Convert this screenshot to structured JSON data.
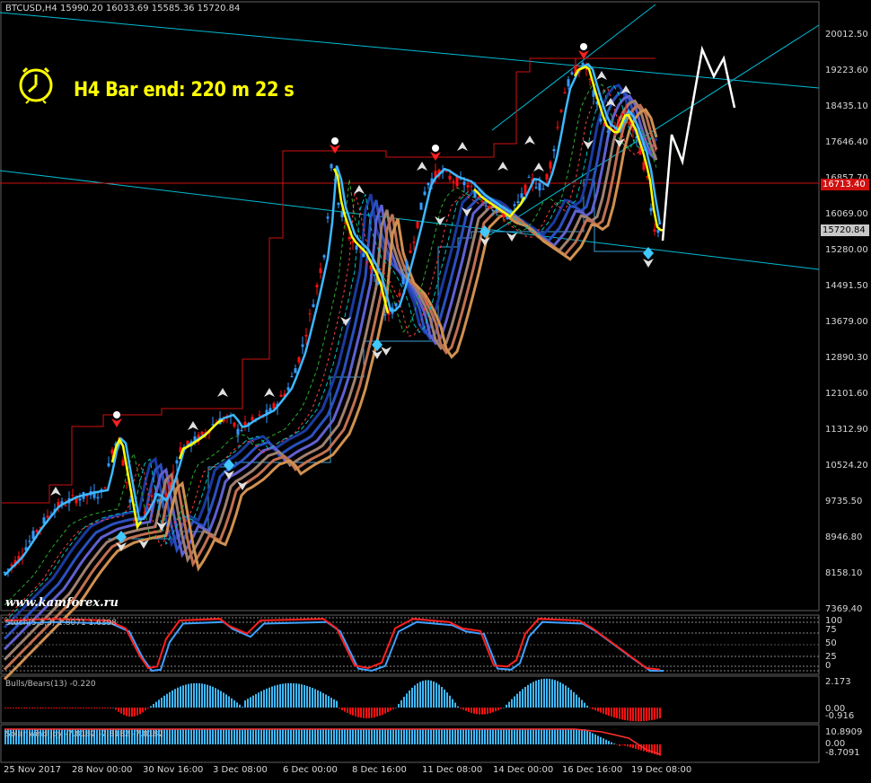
{
  "header": {
    "symbol_info": "BTCUSD,H4  15990.20 16033.69 15585.36 15720.84",
    "timer_text": "H4 Bar end: 220 m 22 s",
    "watermark": "www.kamforex.ru"
  },
  "price_axis": {
    "ticks": [
      "20012.50",
      "19223.60",
      "18435.10",
      "17646.40",
      "16857.70",
      "16069.00",
      "15280.00",
      "14491.50",
      "13679.00",
      "12890.30",
      "12101.60",
      "11312.90",
      "10524.20",
      "9735.50",
      "8946.80",
      "8158.10",
      "7369.40"
    ],
    "red_line_label": "16713.40",
    "current_label": "15720.84"
  },
  "stoch_panel": {
    "label": "Stoch(5,3,3) 1.8071 1.6398",
    "levels": [
      "100",
      "75",
      "50",
      "25",
      "0"
    ]
  },
  "ao_panel": {
    "label": "Bulls/Bears(13) -0.220",
    "levels": [
      "2.173",
      "0.00",
      "-0.916"
    ]
  },
  "solar_panel": {
    "label": "Solar wind joy -7.8182 -7.8182 -7.8182",
    "levels": [
      "10.8909",
      "0.00",
      "-8.7091"
    ]
  },
  "time_axis": {
    "ticks": [
      "25 Nov 2017",
      "28 Nov 00:00",
      "30 Nov 16:00",
      "3 Dec 08:00",
      "6 Dec 00:00",
      "8 Dec 16:00",
      "11 Dec 08:00",
      "14 Dec 00:00",
      "16 Dec 16:00",
      "19 Dec 08:00"
    ]
  },
  "colors": {
    "background": "#000000",
    "bull": "#3399ff",
    "bear": "#ff0000",
    "accent": "#ffff00",
    "channel": "#00bcd4",
    "grid": "#1a2a3a"
  },
  "icons": [
    "clock-icon",
    "up-fractal-arrow-icon",
    "down-fractal-arrow-icon"
  ]
}
